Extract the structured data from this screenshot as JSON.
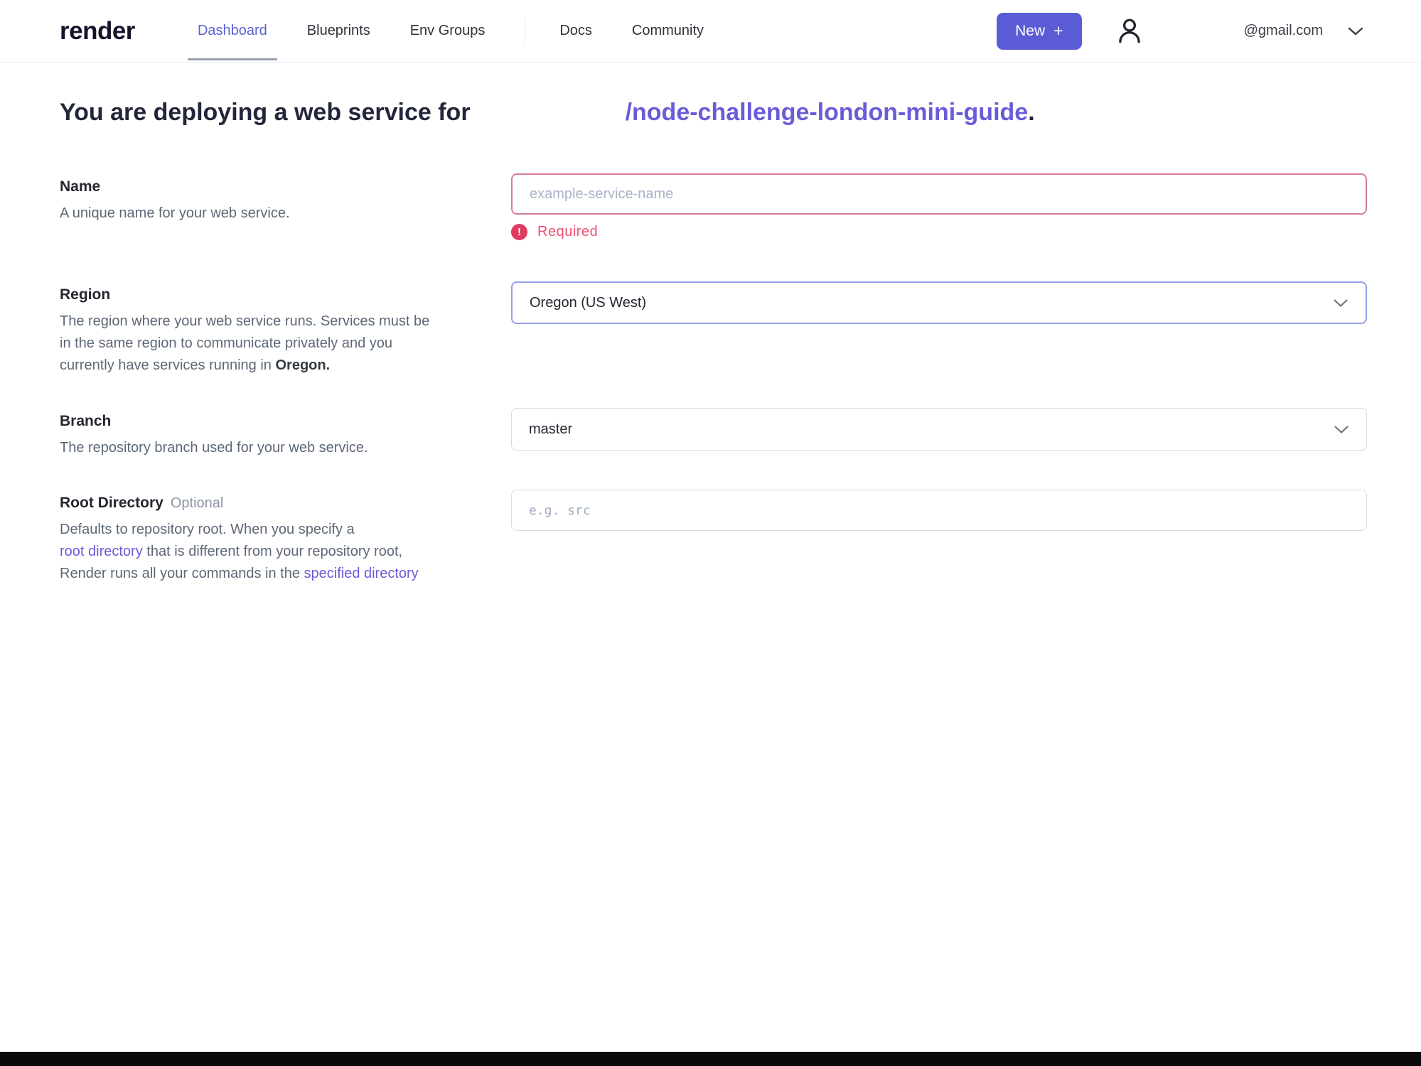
{
  "nav": {
    "logo": "render",
    "items": {
      "dashboard": "Dashboard",
      "blueprints": "Blueprints",
      "env_groups": "Env Groups",
      "docs": "Docs",
      "community": "Community"
    },
    "new_button_label": "New",
    "new_button_plus": "+",
    "account_email": "@gmail.com"
  },
  "heading": {
    "prefix": "You are deploying a web service for",
    "repo_link": "/node-challenge-london-mini-guide",
    "suffix": "."
  },
  "form": {
    "name": {
      "label": "Name",
      "description": "A unique name for your web service.",
      "placeholder": "example-service-name",
      "error_icon": "!",
      "error": "Required"
    },
    "region": {
      "label": "Region",
      "desc_line1": "The region where your web service runs. Services must be",
      "desc_line2": "in the same region to communicate privately and you",
      "desc_line3": "currently have services running in ",
      "desc_bold": "Oregon.",
      "value": "Oregon (US West)"
    },
    "branch": {
      "label": "Branch",
      "description": "The repository branch used for your web service.",
      "value": "master"
    },
    "root_directory": {
      "label": "Root Directory",
      "optional": "Optional",
      "desc_line1": "Defaults to repository root. When you specify a",
      "desc_link1": "root directory",
      "desc_line2_rest": " that is different from your repository root,",
      "desc_line3_start": "Render runs all your commands in the ",
      "desc_link2": "specified directory",
      "placeholder": "e.g. src"
    }
  },
  "colors": {
    "accent_purple": "#5b5bd6",
    "link_purple": "#6a5cd8",
    "active_nav_purple": "#5a62d2",
    "error_pink": "#ed4f75",
    "error_icon_red": "#e13b64"
  }
}
